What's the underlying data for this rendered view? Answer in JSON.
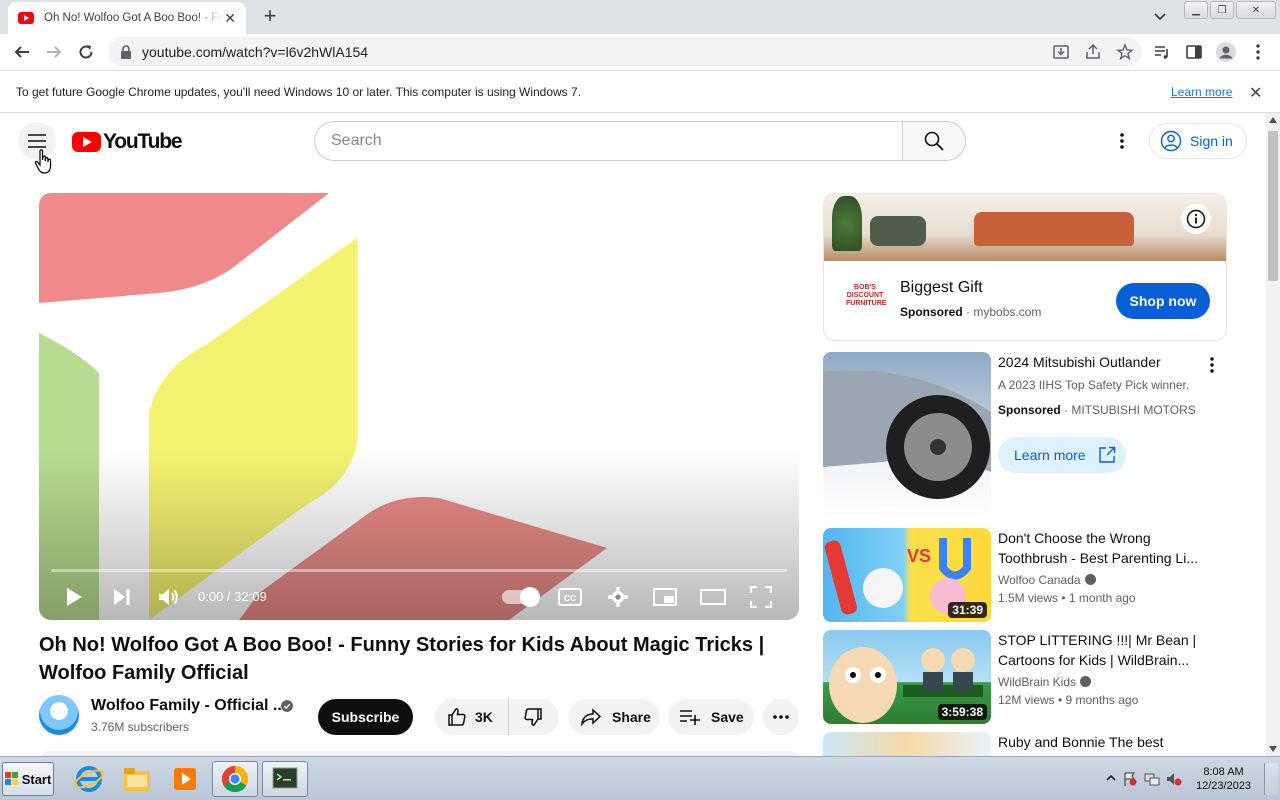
{
  "browser": {
    "tab_title": "Oh No! Wolfoo Got A Boo Boo! - Fu",
    "url": "youtube.com/watch?v=l6v2hWlA154",
    "infobar_text": "To get future Google Chrome updates, you'll need Windows 10 or later. This computer is using Windows 7.",
    "infobar_link": "Learn more"
  },
  "youtube": {
    "logo_text": "YouTube",
    "search_placeholder": "Search",
    "signin_label": "Sign in"
  },
  "player": {
    "timecode": "0:00 / 32:09",
    "progress_fraction": 0
  },
  "video": {
    "title": "Oh No! Wolfoo Got A Boo Boo! - Funny Stories for Kids About Magic Tricks | Wolfoo Family Official",
    "channel_name": "Wolfoo Family - Official ...",
    "subscribers": "3.76M subscribers",
    "subscribe_label": "Subscribe",
    "likes": "3K",
    "share_label": "Share",
    "save_label": "Save"
  },
  "ad": {
    "brand_text": "BOB'S DISCOUNT FURNITURE",
    "title": "Biggest Gift",
    "sponsored": "Sponsored",
    "domain": "mybobs.com",
    "cta": "Shop now"
  },
  "recommendations": [
    {
      "title": "2024 Mitsubishi Outlander",
      "desc": "A 2023 IIHS Top Safety Pick winner.",
      "sponsored": "Sponsored",
      "advertiser": "MITSUBISHI MOTORS",
      "cta": "Learn more"
    },
    {
      "title": "Don't Choose the Wrong Toothbrush - Best Parenting Li...",
      "channel": "Wolfoo Canada",
      "meta": "1.5M views • 1 month ago",
      "duration": "31:39"
    },
    {
      "title": "STOP LITTERING !!!| Mr Bean | Cartoons for Kids | WildBrain...",
      "channel": "WildBrain Kids",
      "meta": "12M views • 9 months ago",
      "duration": "3:59:38"
    },
    {
      "title": "Ruby and Bonnie The best"
    }
  ],
  "taskbar": {
    "start_label": "Start",
    "time": "8:08 AM",
    "date": "12/23/2023"
  },
  "colors": {
    "youtube_red": "#ff0000",
    "link_blue": "#065fd4",
    "shop_blue": "#065fd4"
  }
}
